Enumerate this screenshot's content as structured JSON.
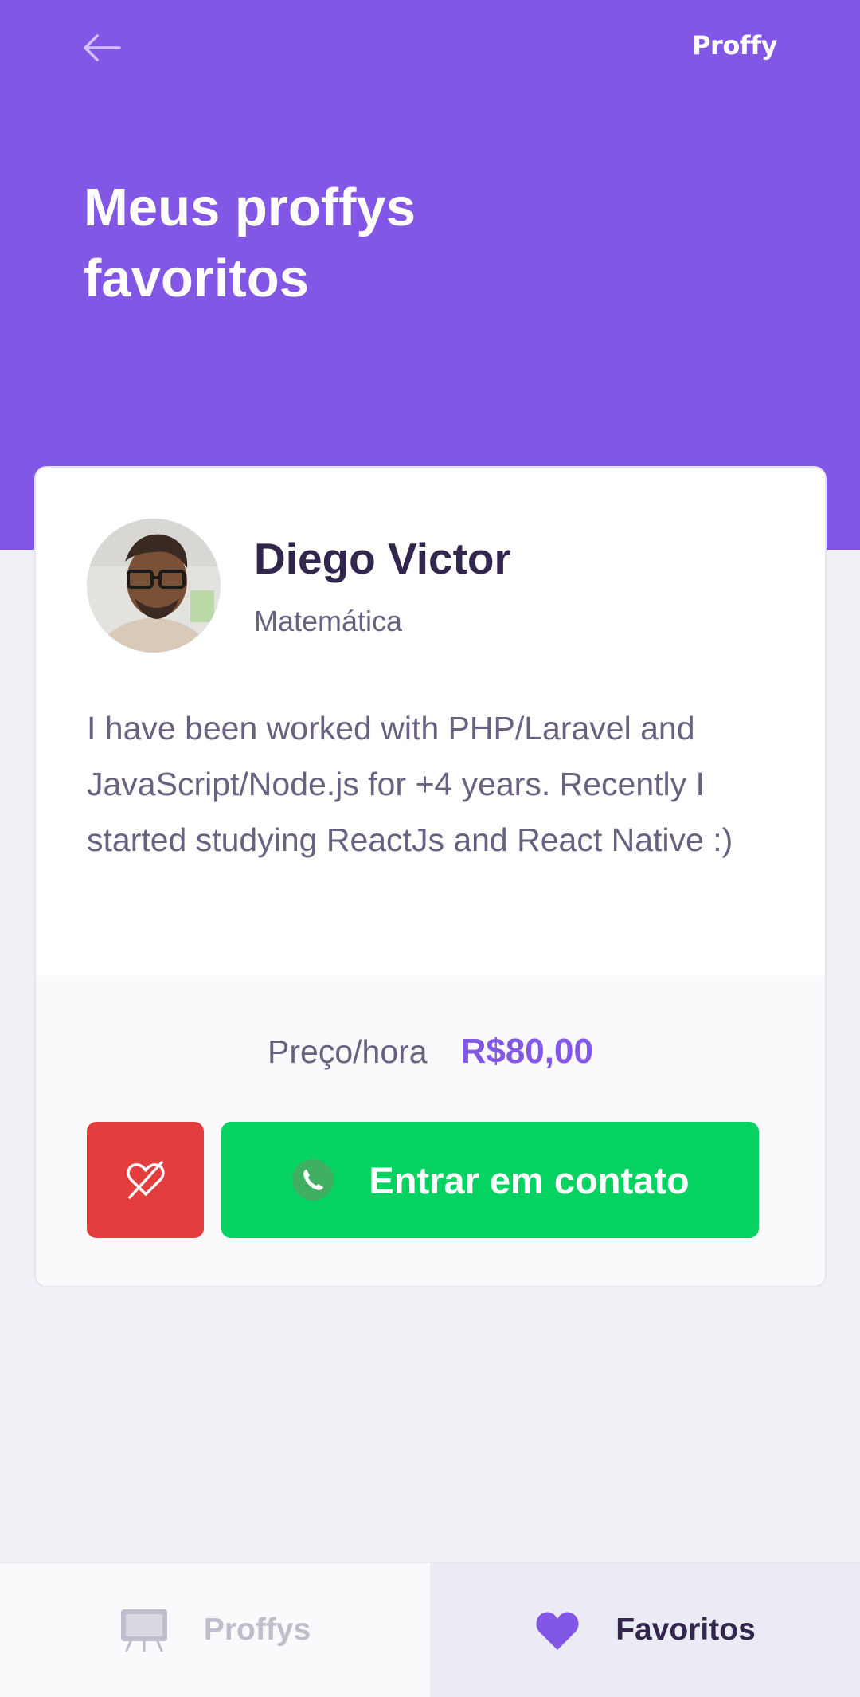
{
  "header": {
    "logo": "Proffy",
    "title": "Meus proffys favoritos",
    "back_icon": "arrow-left-icon"
  },
  "teacher": {
    "name": "Diego Victor",
    "subject": "Matemática",
    "bio": "I have been worked with PHP/Laravel and JavaScript/Node.js for +4 years. Recently I started studying ReactJs and React Native :)",
    "price_label": "Preço/hora",
    "price_value": "R$80,00",
    "contact_label": "Entrar em contato",
    "unfavorite_icon": "heart-outline-icon",
    "contact_icon": "whatsapp-icon"
  },
  "tabs": [
    {
      "label": "Proffys",
      "icon": "easel-icon",
      "active": false
    },
    {
      "label": "Favoritos",
      "icon": "heart-icon",
      "active": true
    }
  ],
  "colors": {
    "primary": "#8257E5",
    "background": "#F0F0F7",
    "danger": "#E33D3D",
    "success": "#04D361",
    "title_text": "#32264D",
    "body_text": "#6A6180"
  }
}
